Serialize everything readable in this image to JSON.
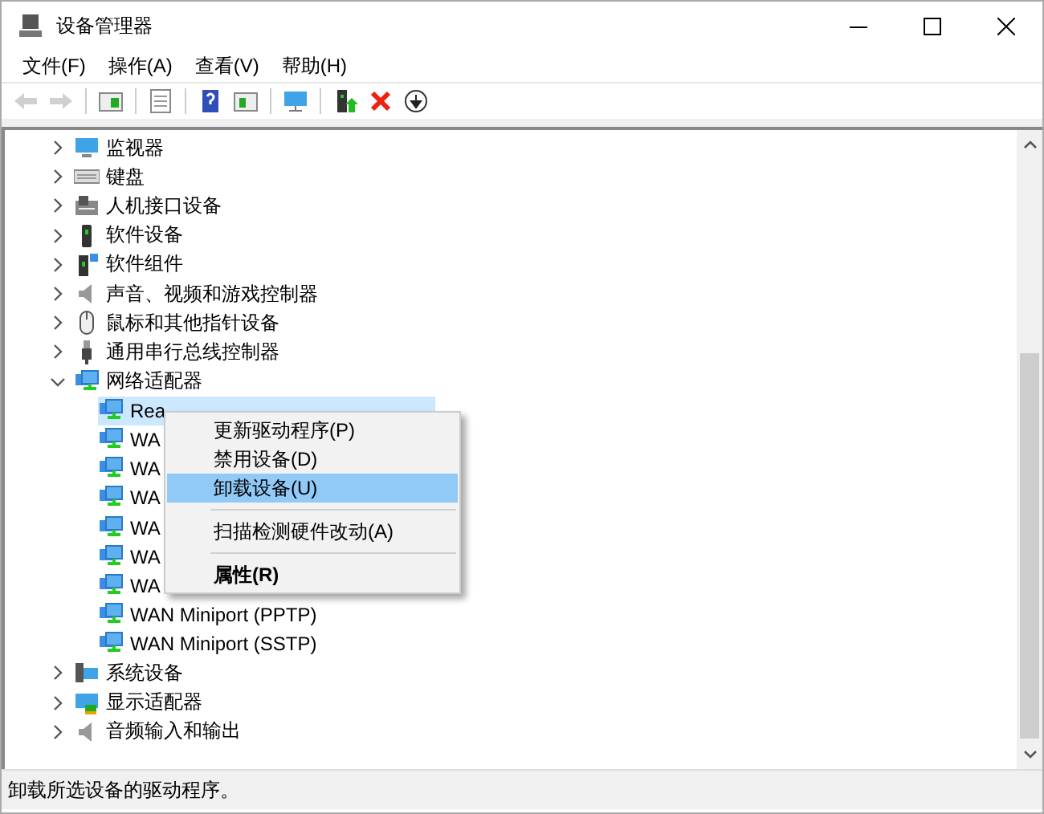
{
  "window": {
    "title": "设备管理器"
  },
  "menu": [
    "文件(F)",
    "操作(A)",
    "查看(V)",
    "帮助(H)"
  ],
  "toolbar": [
    {
      "disabled": true
    },
    {
      "disabled": true
    },
    {
      "disabled": false
    },
    {
      "disabled": false
    },
    {
      "disabled": false
    },
    {
      "disabled": false
    },
    {
      "disabled": false
    },
    {
      "disabled": false
    },
    {
      "disabled": false
    },
    {
      "disabled": false
    }
  ],
  "tree": [
    {
      "label": "监视器",
      "expanded": false,
      "selected": false
    },
    {
      "label": "键盘",
      "expanded": false,
      "selected": false
    },
    {
      "label": "人机接口设备",
      "expanded": false,
      "selected": false
    },
    {
      "label": "软件设备",
      "expanded": false,
      "selected": false
    },
    {
      "label": "软件组件",
      "expanded": false,
      "selected": false
    },
    {
      "label": "声音、视频和游戏控制器",
      "expanded": false,
      "selected": false
    },
    {
      "label": "鼠标和其他指针设备",
      "expanded": false,
      "selected": false
    },
    {
      "label": "通用串行总线控制器",
      "expanded": false,
      "selected": false
    },
    {
      "label": "网络适配器",
      "expanded": true,
      "selected": false,
      "children": [
        {
          "label": "Rea",
          "selected": true
        },
        {
          "label": "WA",
          "selected": false
        },
        {
          "label": "WA",
          "selected": false
        },
        {
          "label": "WA",
          "selected": false
        },
        {
          "label": "WA",
          "selected": false
        },
        {
          "label": "WA",
          "selected": false
        },
        {
          "label": "WA",
          "selected": false
        },
        {
          "label": "WAN Miniport (PPTP)",
          "selected": false
        },
        {
          "label": "WAN Miniport (SSTP)",
          "selected": false
        }
      ]
    },
    {
      "label": "系统设备",
      "expanded": false,
      "selected": false
    },
    {
      "label": "显示适配器",
      "expanded": false,
      "selected": false
    },
    {
      "label": "音频输入和输出",
      "expanded": false,
      "selected": false
    }
  ],
  "context_menu": {
    "items": [
      {
        "kind": "item",
        "label": "更新驱动程序(P)",
        "selected": false,
        "default": false
      },
      {
        "kind": "item",
        "label": "禁用设备(D)",
        "selected": false,
        "default": false
      },
      {
        "kind": "item",
        "label": "卸载设备(U)",
        "selected": true,
        "default": false
      },
      {
        "kind": "separator"
      },
      {
        "kind": "item",
        "label": "扫描检测硬件改动(A)",
        "selected": false,
        "default": false
      },
      {
        "kind": "separator"
      },
      {
        "kind": "item",
        "label": "属性(R)",
        "selected": false,
        "default": true
      }
    ]
  },
  "status_bar": "卸载所选设备的驱动程序。"
}
